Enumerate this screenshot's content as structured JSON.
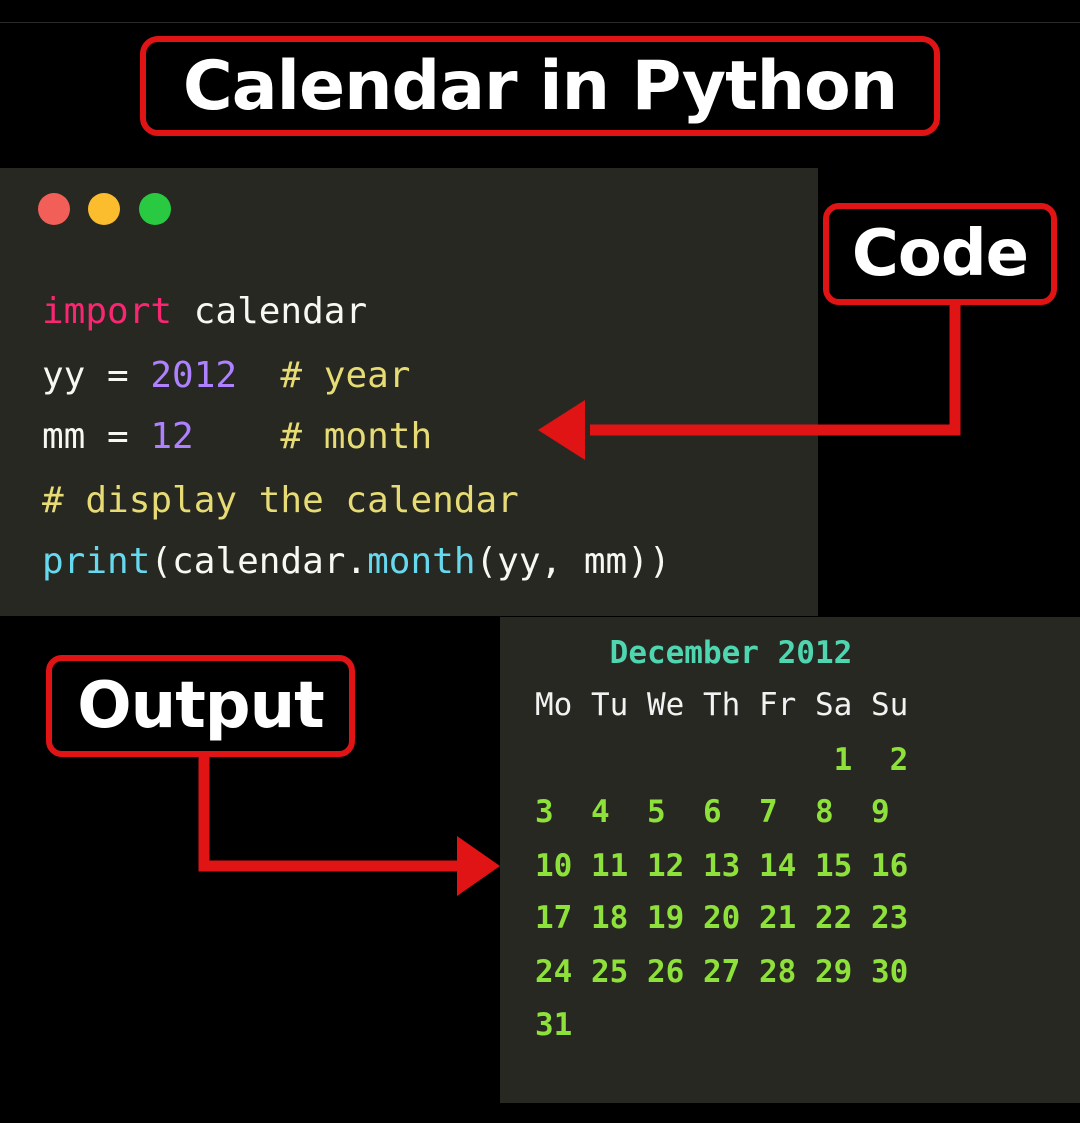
{
  "title": "Calendar in Python",
  "code_label": "Code",
  "output_label": "Output",
  "window_dots": [
    "red",
    "yellow",
    "green"
  ],
  "code": {
    "line1": {
      "keyword": "import",
      "rest": " calendar"
    },
    "line2": {
      "var": "yy = ",
      "number": "2012",
      "comment": "  # year"
    },
    "line3": {
      "var": "mm = ",
      "number": "12",
      "comment": "    # month"
    },
    "line4": {
      "comment": "# display the calendar"
    },
    "line5": {
      "fn": "print",
      "a": "(calendar.",
      "method": "month",
      "b": "(yy, mm))"
    }
  },
  "output": {
    "header": "    December 2012",
    "days": "Mo Tu We Th Fr Sa Su",
    "weeks": [
      "                1  2",
      "3  4  5  6  7  8  9",
      "10 11 12 13 14 15 16",
      "17 18 19 20 21 22 23",
      "24 25 26 27 28 29 30",
      "31"
    ]
  },
  "colors": {
    "accent_red": "#e01414",
    "code_bg": "#272822",
    "keyword": "#f92672",
    "number": "#ae81ff",
    "comment": "#e6db74",
    "function": "#66d9ef",
    "calendar_header": "#4fd6b0",
    "calendar_numbers": "#8ee03a"
  }
}
